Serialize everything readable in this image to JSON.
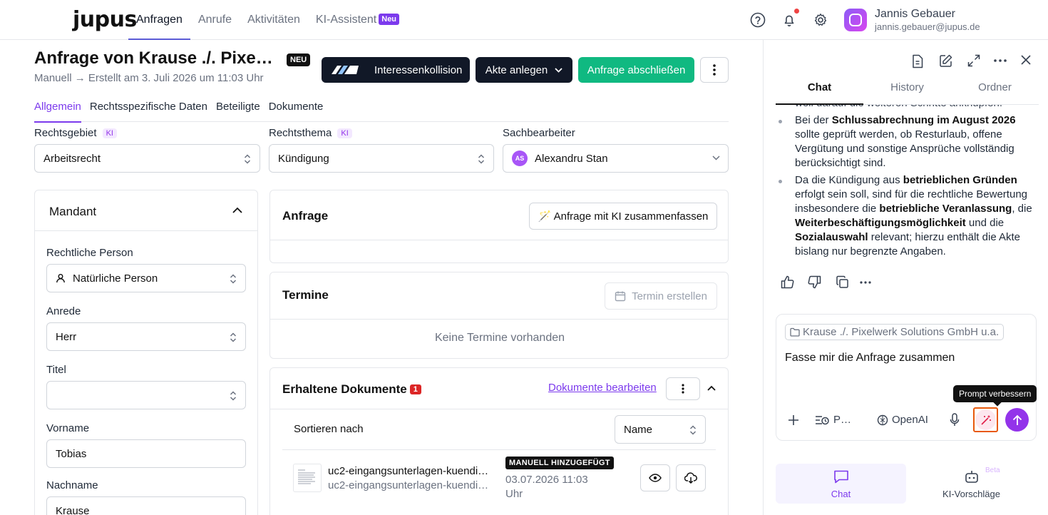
{
  "app": {
    "logo": "jupus",
    "nav": [
      {
        "label": "Anfragen",
        "active": true
      },
      {
        "label": "Anrufe",
        "active": false
      },
      {
        "label": "Aktivitäten",
        "active": false
      },
      {
        "label": "KI-Assistent",
        "active": false,
        "badge": "Neu"
      }
    ],
    "user": {
      "name": "Jannis Gebauer",
      "email": "jannis.gebauer@jupus.de"
    }
  },
  "header": {
    "title": "Anfrage von Krause ./. Pixe…",
    "badge": "NEU",
    "subtitle": "Manuell → Erstellt am 3. Juli 2026 um 11:03 Uhr",
    "conflict_button": "Interessenkollision",
    "create_file_button": "Akte anlegen",
    "close_request_button": "Anfrage abschließen"
  },
  "tabs": [
    {
      "label": "Allgemein",
      "active": true
    },
    {
      "label": "Rechtsspezifische Daten",
      "active": false
    },
    {
      "label": "Beteiligte",
      "active": false
    },
    {
      "label": "Dokumente",
      "active": false
    }
  ],
  "fields": {
    "rechtsgebiet": {
      "label": "Rechtsgebiet",
      "badge": "KI",
      "value": "Arbeitsrecht"
    },
    "rechtsthema": {
      "label": "Rechtsthema",
      "badge": "KI",
      "value": "Kündigung"
    },
    "sachbearbeiter": {
      "label": "Sachbearbeiter",
      "initials": "AS",
      "value": "Alexandru Stan"
    }
  },
  "mandant": {
    "title": "Mandant",
    "rechtliche_person": {
      "label": "Rechtliche Person",
      "value": "Natürliche Person"
    },
    "anrede": {
      "label": "Anrede",
      "value": "Herr"
    },
    "titel": {
      "label": "Titel",
      "value": ""
    },
    "vorname": {
      "label": "Vorname",
      "value": "Tobias"
    },
    "nachname": {
      "label": "Nachname",
      "value": "Krause"
    }
  },
  "anfrage": {
    "title": "Anfrage",
    "ai_button": "🪄 Anfrage mit KI zusammenfassen"
  },
  "termine": {
    "title": "Termine",
    "create_button": "Termin erstellen",
    "empty": "Keine Termine vorhanden"
  },
  "dokumente": {
    "title": "Erhaltene Dokumente",
    "count": "1",
    "edit_link": "Dokumente bearbeiten",
    "sort_label": "Sortieren nach",
    "sort_value": "Name",
    "items": [
      {
        "name": "uc2-eingangsunterlagen-kuendi…",
        "subname": "uc2-eingangsunterlagen-kuendi…",
        "tag": "MANUELL HINZUGEFÜGT",
        "date": "03.07.2026 11:03",
        "date_suffix": "Uhr"
      }
    ]
  },
  "chat_panel": {
    "tabs": [
      {
        "label": "Chat",
        "active": true
      },
      {
        "label": "History",
        "active": false
      },
      {
        "label": "Ordner",
        "active": false
      }
    ],
    "cut_line": "weil darauf die weiteren Schritte anknüpfen.",
    "bullet1": {
      "pre": "Bei der ",
      "bold1": "Schlussabrechnung im August 2026",
      "post": " sollte geprüft werden, ob Resturlaub, offene Vergütung und sonstige Ansprüche vollständig berücksichtigt sind."
    },
    "bullet2": {
      "pre": "Da die Kündigung aus ",
      "bold1": "betrieblichen Gründen",
      "mid1": " erfolgt sein soll, sind für die rechtliche Bewertung insbesondere die ",
      "bold2": "betriebliche Veranlassung",
      "mid2": ", die ",
      "bold3": "Weiterbeschäftigungsmöglichkeit",
      "mid3": " und die ",
      "bold4": "Sozialauswahl",
      "post": " relevant; hierzu enthält die Akte bislang nur begrenzte Angaben."
    },
    "context_chip": "Krause ./. Pixelwerk Solutions GmbH u.a.",
    "prompt": "Fasse mir die Anfrage zusammen",
    "prompts_button": "P…",
    "model": "OpenAI",
    "tooltip": "Prompt verbessern",
    "bottom_nav": [
      {
        "label": "Chat",
        "active": true
      },
      {
        "label": "KI-Vorschläge",
        "active": false,
        "badge": "Beta"
      }
    ]
  }
}
